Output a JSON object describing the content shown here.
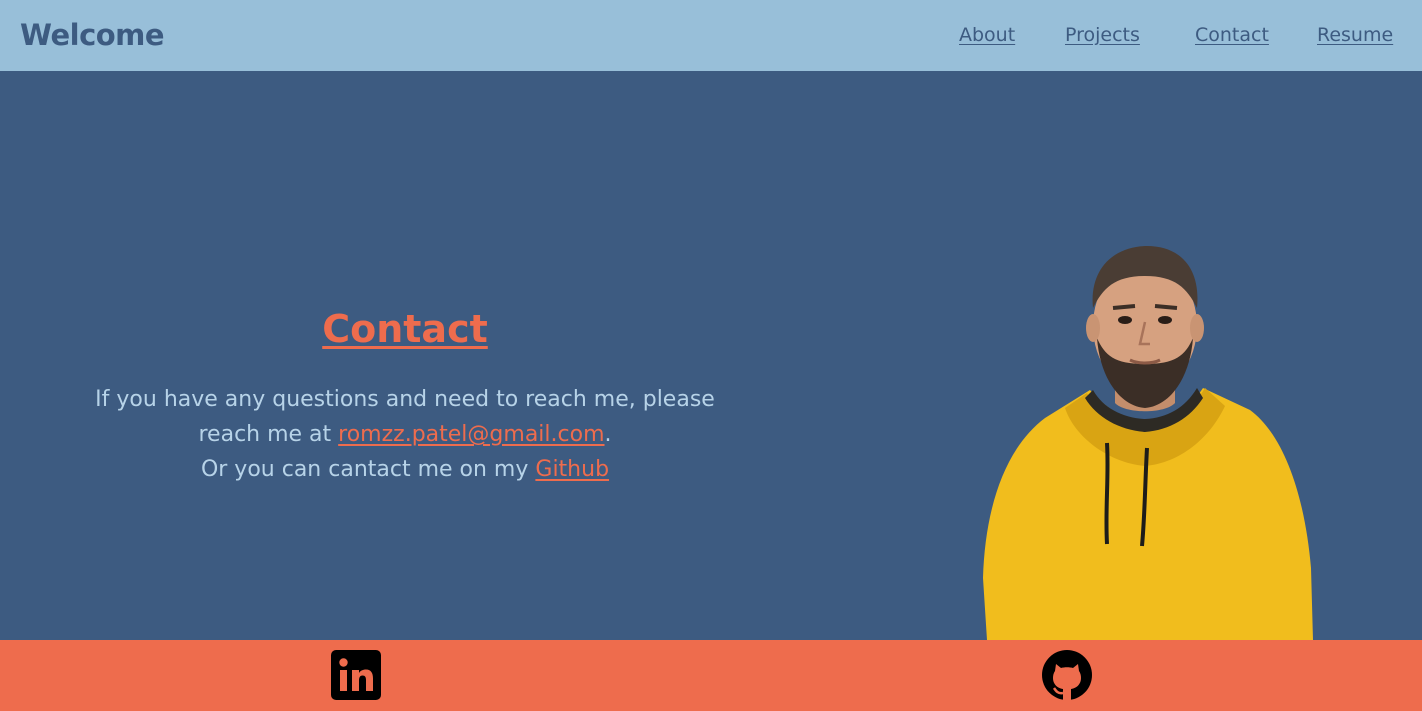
{
  "header": {
    "brand": "Welcome",
    "nav": [
      {
        "label": "About"
      },
      {
        "label": "Projects"
      },
      {
        "label": "Contact"
      },
      {
        "label": "Resume"
      }
    ]
  },
  "contact": {
    "heading": "Contact",
    "line1_prefix": "If you have any questions and need to reach me, please",
    "line2_prefix": "reach me at ",
    "email": "romzz.patel@gmail.com",
    "line2_suffix": ".",
    "line3_prefix": "Or you can cantact me on my ",
    "github_link": "Github"
  },
  "portrait": {
    "icon": "person-portrait"
  },
  "footer": {
    "icons": [
      "linkedin-icon",
      "github-icon"
    ]
  },
  "colors": {
    "header_bg": "#98bfd9",
    "main_bg": "#3d5b81",
    "accent": "#ee6c4d",
    "body_text": "#b7d3e8",
    "hoodie": "#f1bd1d"
  }
}
